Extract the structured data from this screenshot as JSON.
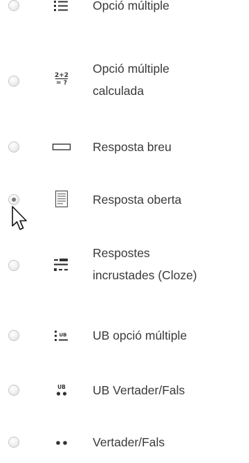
{
  "question_types": [
    {
      "label": "Opció múltiple",
      "icon": "multichoice-icon",
      "selected": false
    },
    {
      "label": "Opció múltiple",
      "label_line2": "calculada",
      "icon": "calculated-multichoice-icon",
      "icon_text": [
        "2+2",
        "= ?"
      ],
      "selected": false
    },
    {
      "label": "Resposta breu",
      "icon": "short-answer-icon",
      "selected": false
    },
    {
      "label": "Resposta oberta",
      "icon": "essay-icon",
      "selected": true
    },
    {
      "label": "Respostes",
      "label_line2": "incrustades (Cloze)",
      "icon": "cloze-icon",
      "selected": false
    },
    {
      "label": "UB opció múltiple",
      "icon": "ub-multichoice-icon",
      "icon_text": "UB",
      "selected": false
    },
    {
      "label": "UB Vertader/Fals",
      "icon": "ub-truefalse-icon",
      "icon_text": "UB",
      "selected": false
    },
    {
      "label": "Vertader/Fals",
      "icon": "truefalse-icon",
      "selected": false
    }
  ],
  "colors": {
    "text": "#3a3a3a",
    "icon": "#333333",
    "radio_border": "#c7c7c7"
  },
  "cursor": "arrow-pointer-icon"
}
